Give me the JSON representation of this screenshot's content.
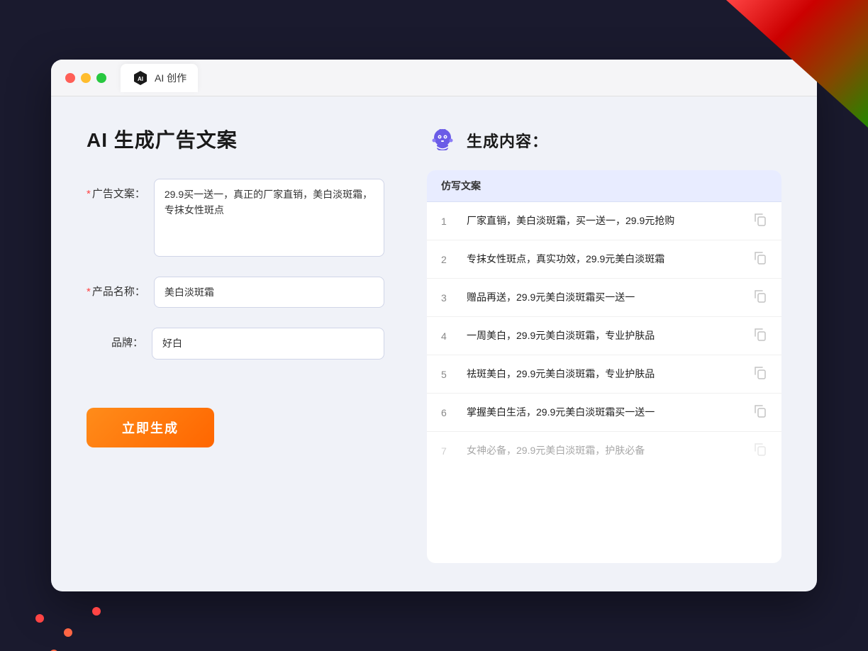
{
  "window": {
    "tab_label": "AI 创作"
  },
  "left": {
    "page_title": "AI 生成广告文案",
    "fields": [
      {
        "id": "ad_copy",
        "label": "广告文案：",
        "required": true,
        "type": "textarea",
        "value": "29.9买一送一，真正的厂家直销，美白淡斑霜，专抹女性斑点"
      },
      {
        "id": "product_name",
        "label": "产品名称：",
        "required": true,
        "type": "input",
        "value": "美白淡斑霜"
      },
      {
        "id": "brand",
        "label": "品牌：",
        "required": false,
        "type": "input",
        "value": "好白"
      }
    ],
    "generate_btn": "立即生成"
  },
  "right": {
    "title": "生成内容：",
    "column_header": "仿写文案",
    "results": [
      {
        "num": 1,
        "text": "厂家直销，美白淡斑霜，买一送一，29.9元抢购"
      },
      {
        "num": 2,
        "text": "专抹女性斑点，真实功效，29.9元美白淡斑霜"
      },
      {
        "num": 3,
        "text": "赠品再送，29.9元美白淡斑霜买一送一"
      },
      {
        "num": 4,
        "text": "一周美白，29.9元美白淡斑霜，专业护肤品"
      },
      {
        "num": 5,
        "text": "祛斑美白，29.9元美白淡斑霜，专业护肤品"
      },
      {
        "num": 6,
        "text": "掌握美白生活，29.9元美白淡斑霜买一送一"
      },
      {
        "num": 7,
        "text": "女神必备，29.9元美白淡斑霜，护肤必备",
        "faded": true
      }
    ]
  }
}
